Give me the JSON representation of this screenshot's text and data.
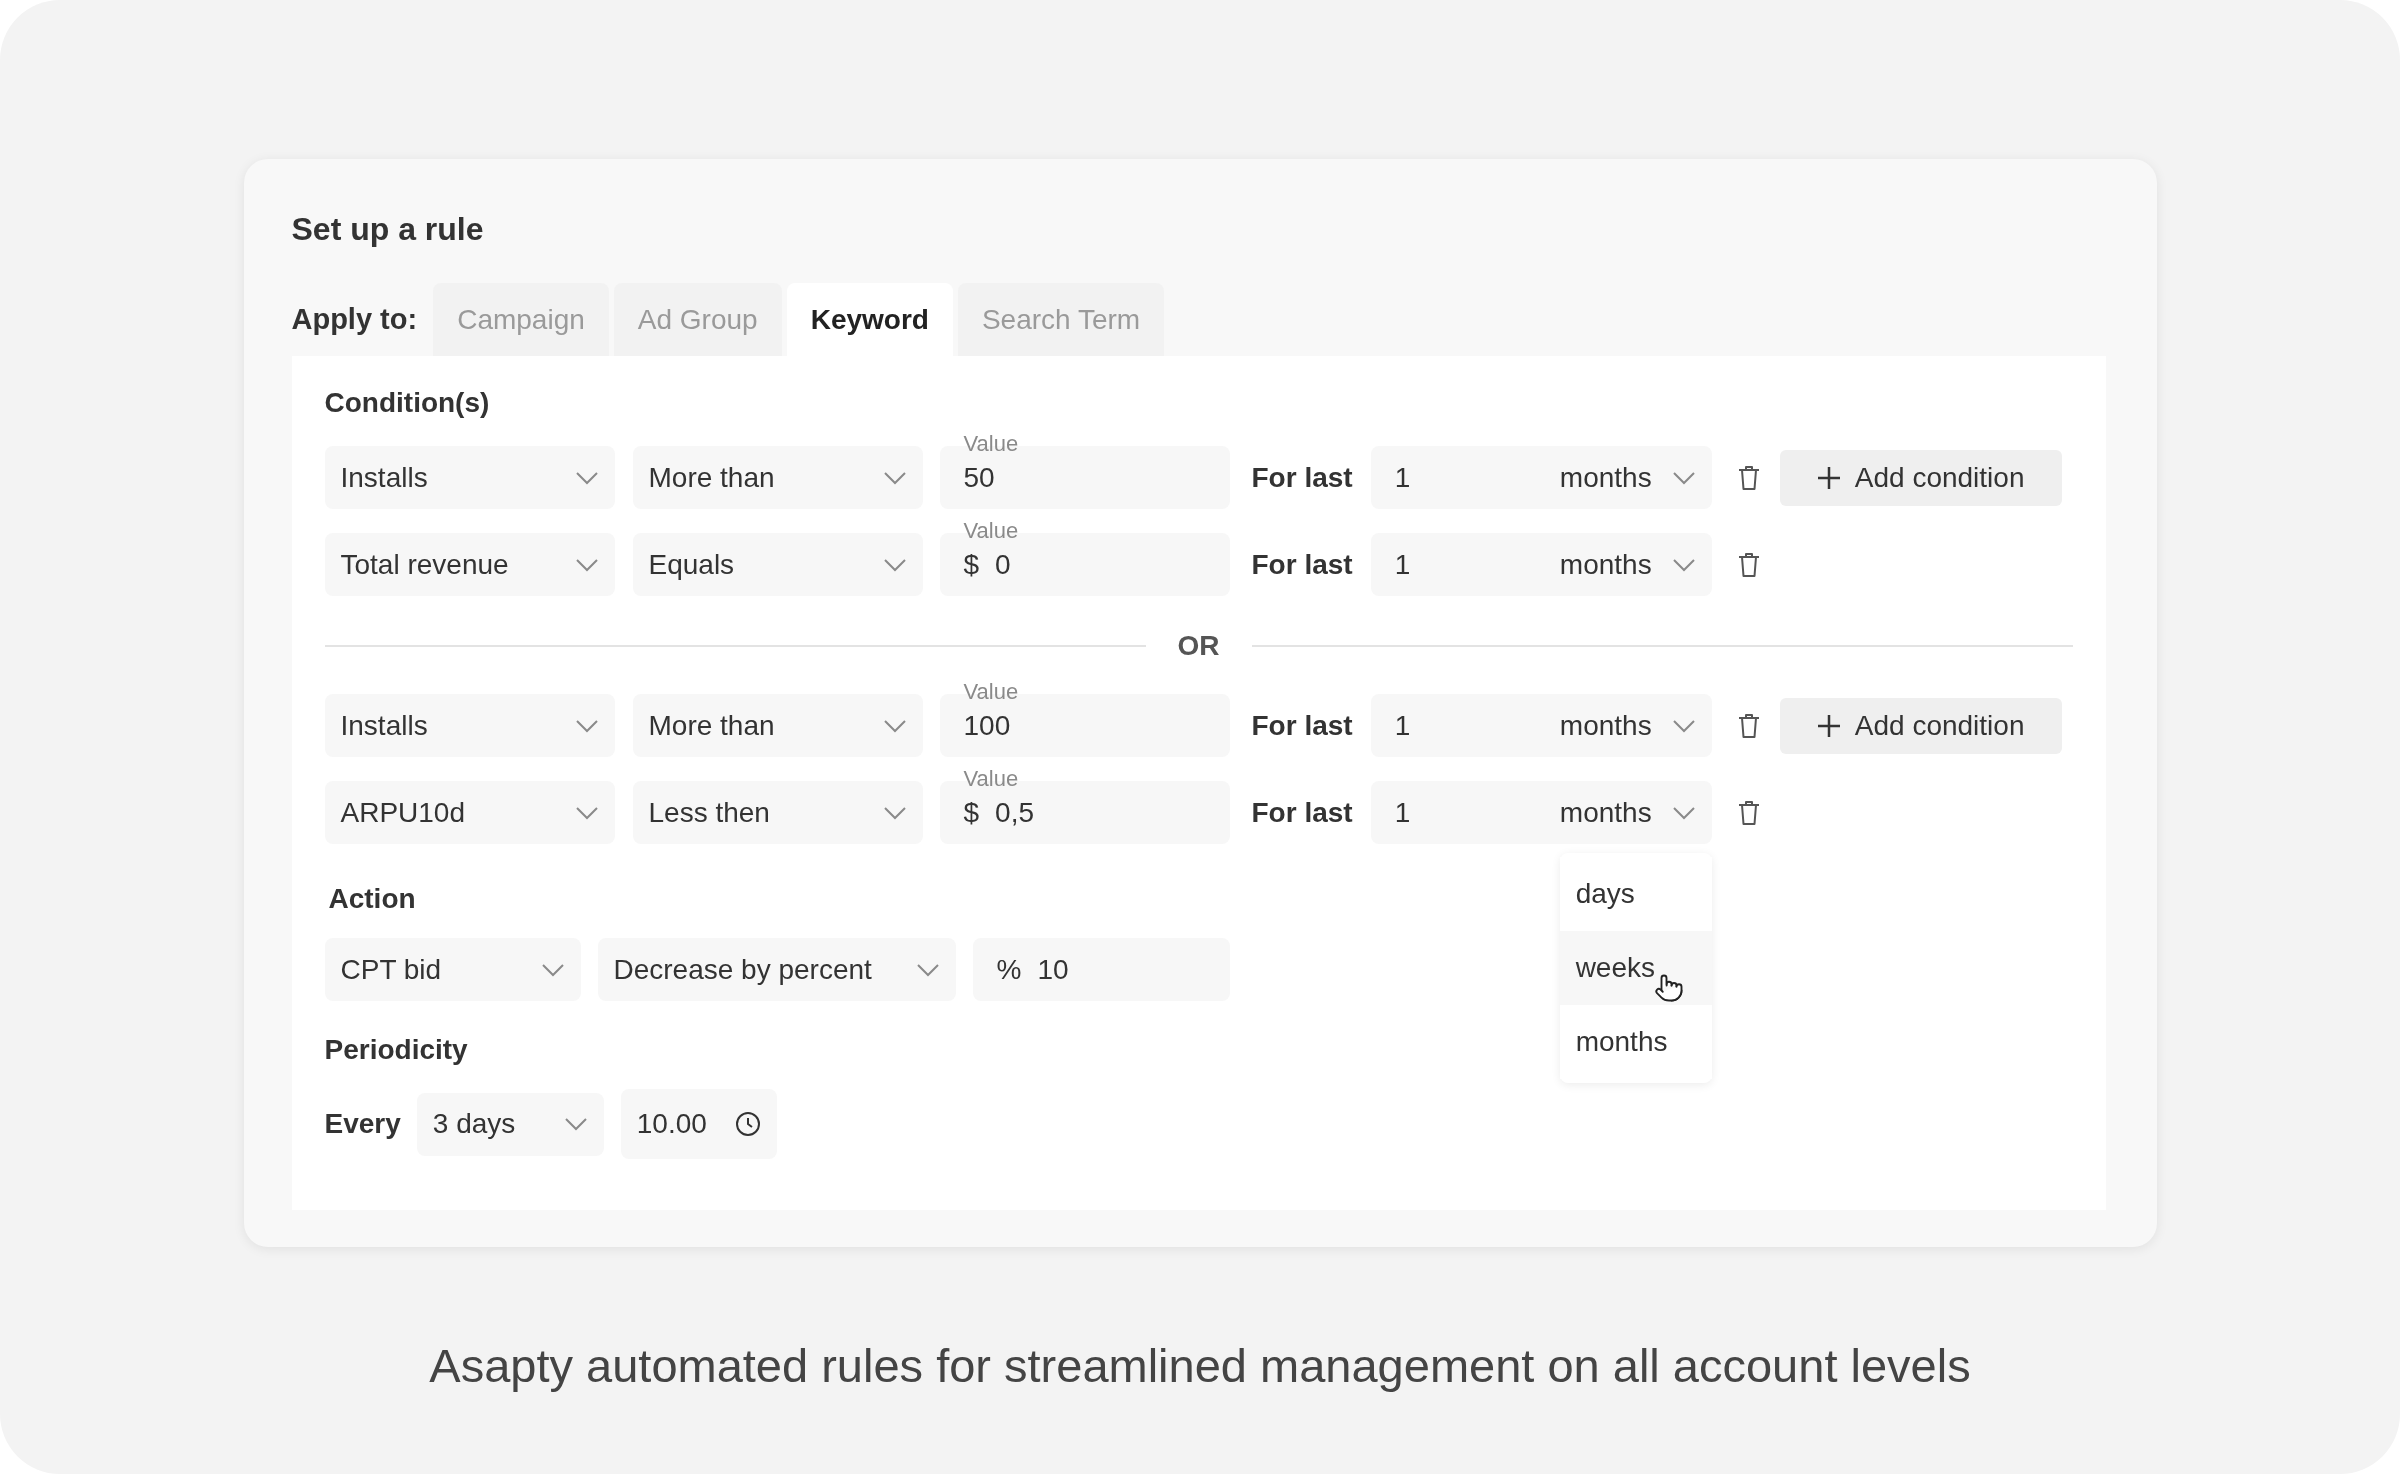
{
  "title": "Set up a rule",
  "apply_to": {
    "label": "Apply to:",
    "tabs": [
      {
        "label": "Campaign",
        "selected": false
      },
      {
        "label": "Ad Group",
        "selected": false
      },
      {
        "label": "Keyword",
        "selected": true
      },
      {
        "label": "Search Term",
        "selected": false
      }
    ]
  },
  "conditions": {
    "heading": "Condition(s)",
    "separator": "OR",
    "groups": [
      {
        "rows": [
          {
            "metric": "Installs",
            "operator": "More than",
            "value_label": "Value",
            "currency": "",
            "value": "50",
            "for_last": "For last",
            "count": "1",
            "unit": "months",
            "add_button": "Add condition"
          },
          {
            "metric": "Total revenue",
            "operator": "Equals",
            "value_label": "Value",
            "currency": "$",
            "value": "0",
            "for_last": "For last",
            "count": "1",
            "unit": "months",
            "add_button": ""
          }
        ]
      },
      {
        "rows": [
          {
            "metric": "Installs",
            "operator": "More than",
            "value_label": "Value",
            "currency": "",
            "value": "100",
            "for_last": "For last",
            "count": "1",
            "unit": "months",
            "add_button": "Add condition"
          },
          {
            "metric": "ARPU10d",
            "operator": "Less then",
            "value_label": "Value",
            "currency": "$",
            "value": "0,5",
            "for_last": "For last",
            "count": "1",
            "unit": "months",
            "add_button": "",
            "unit_menu": [
              {
                "label": "days",
                "highlighted": false
              },
              {
                "label": "weeks",
                "highlighted": true
              },
              {
                "label": "months",
                "highlighted": false
              }
            ]
          }
        ]
      }
    ]
  },
  "action": {
    "heading": "Action",
    "target": "CPT bid",
    "operation": "Decrease by percent",
    "unit": "%",
    "value": "10"
  },
  "periodicity": {
    "heading": "Periodicity",
    "label": "Every",
    "interval": "3 days",
    "time": "10.00"
  },
  "caption": "Asapty automated rules for streamlined management on all account levels"
}
